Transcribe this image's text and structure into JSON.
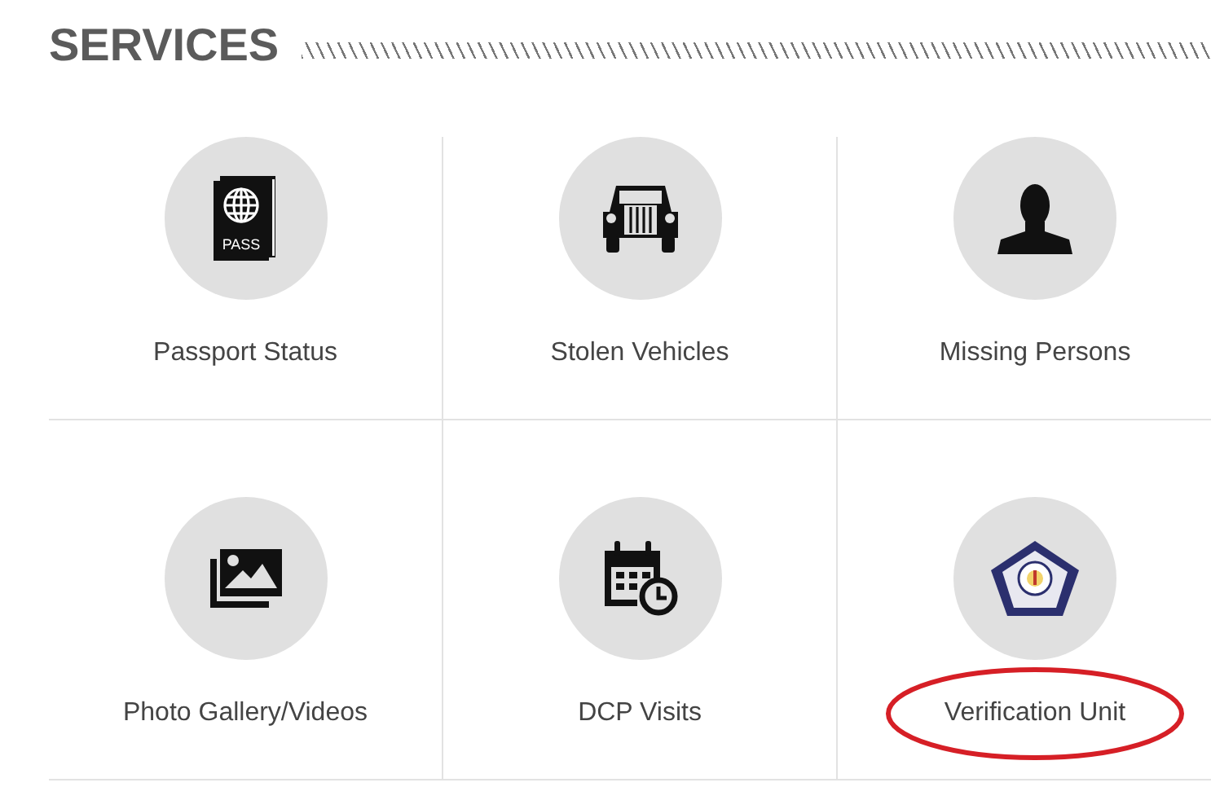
{
  "heading": "SERVICES",
  "services": [
    {
      "kind": "passport",
      "label": "Passport Status",
      "icon_text": "PASS",
      "circled": false
    },
    {
      "kind": "vehicle",
      "label": "Stolen Vehicles",
      "circled": false
    },
    {
      "kind": "person",
      "label": "Missing Persons",
      "circled": false
    },
    {
      "kind": "gallery",
      "label": "Photo Gallery/Videos",
      "circled": false
    },
    {
      "kind": "calendar",
      "label": "DCP Visits",
      "circled": false
    },
    {
      "kind": "badge",
      "label": "Verification Unit",
      "circled": true
    }
  ]
}
